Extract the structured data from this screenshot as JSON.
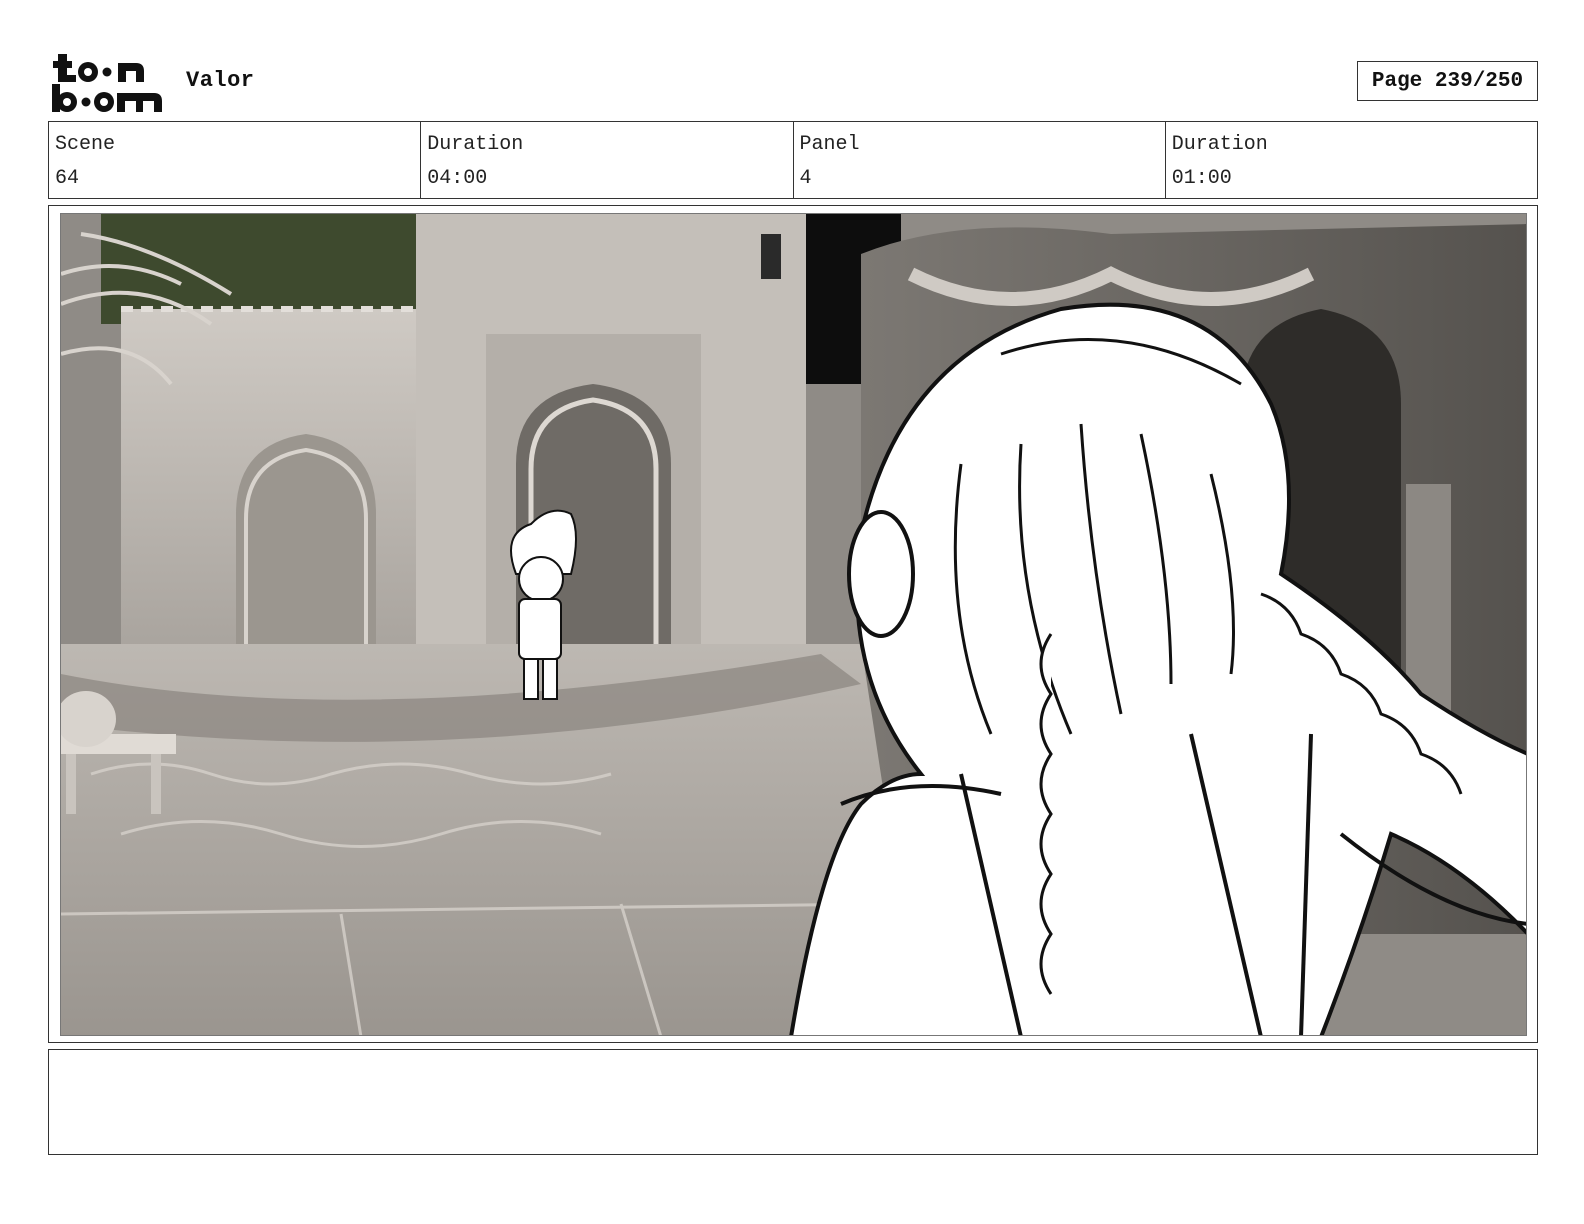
{
  "logo": {
    "alt_text": "toon boom",
    "line1": "toon",
    "line2": "boom"
  },
  "project": {
    "title": "Valor"
  },
  "page": {
    "indicator": "Page 239/250"
  },
  "info": [
    {
      "label": "Scene",
      "value": "64"
    },
    {
      "label": "Duration",
      "value": "04:00"
    },
    {
      "label": "Panel",
      "value": "4"
    },
    {
      "label": "Duration",
      "value": "01:00"
    }
  ],
  "panel": {
    "description": ""
  },
  "notes": {
    "text": ""
  }
}
